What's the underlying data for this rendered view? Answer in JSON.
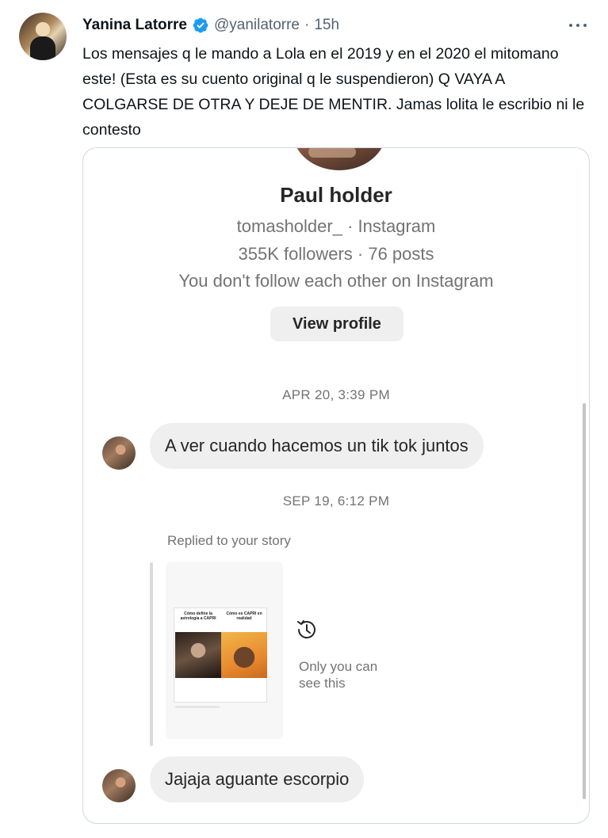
{
  "tweet": {
    "author_name": "Yanina Latorre",
    "handle": "@yanilatorre",
    "separator": "·",
    "time": "15h",
    "text": "Los mensajes q le mando a Lola en el 2019 y en el 2020 el mitomano este! (Esta es su cuento original q le suspendieron) Q VAYA A COLGARSE DE OTRA Y DEJE DE MENTIR. Jamas lolita le escribio ni le contesto",
    "more_icon": "more-horizontal-icon",
    "verified_icon": "verified-badge-icon",
    "accent_color": "#1d9bf0"
  },
  "screenshot": {
    "profile": {
      "name": "Paul holder",
      "username_line": "tomasholder_ · Instagram",
      "stats_line": "355K followers · 76 posts",
      "follow_line": "You don't follow each other on Instagram",
      "view_profile_label": "View profile"
    },
    "messages": {
      "date_1": "APR 20, 3:39 PM",
      "bubble_1": "A ver cuando hacemos un tik tok juntos",
      "date_2": "SEP 19, 6:12 PM",
      "replied_label": "Replied to your story",
      "story_caption_left": "Cómo define la astrología a CAPRI",
      "story_caption_right": "Cómo es CAPRI en realidad",
      "only_you_text": "Only you can\nsee this",
      "history_icon": "history-icon",
      "bubble_2": "Jajaja aguante escorpio"
    }
  }
}
